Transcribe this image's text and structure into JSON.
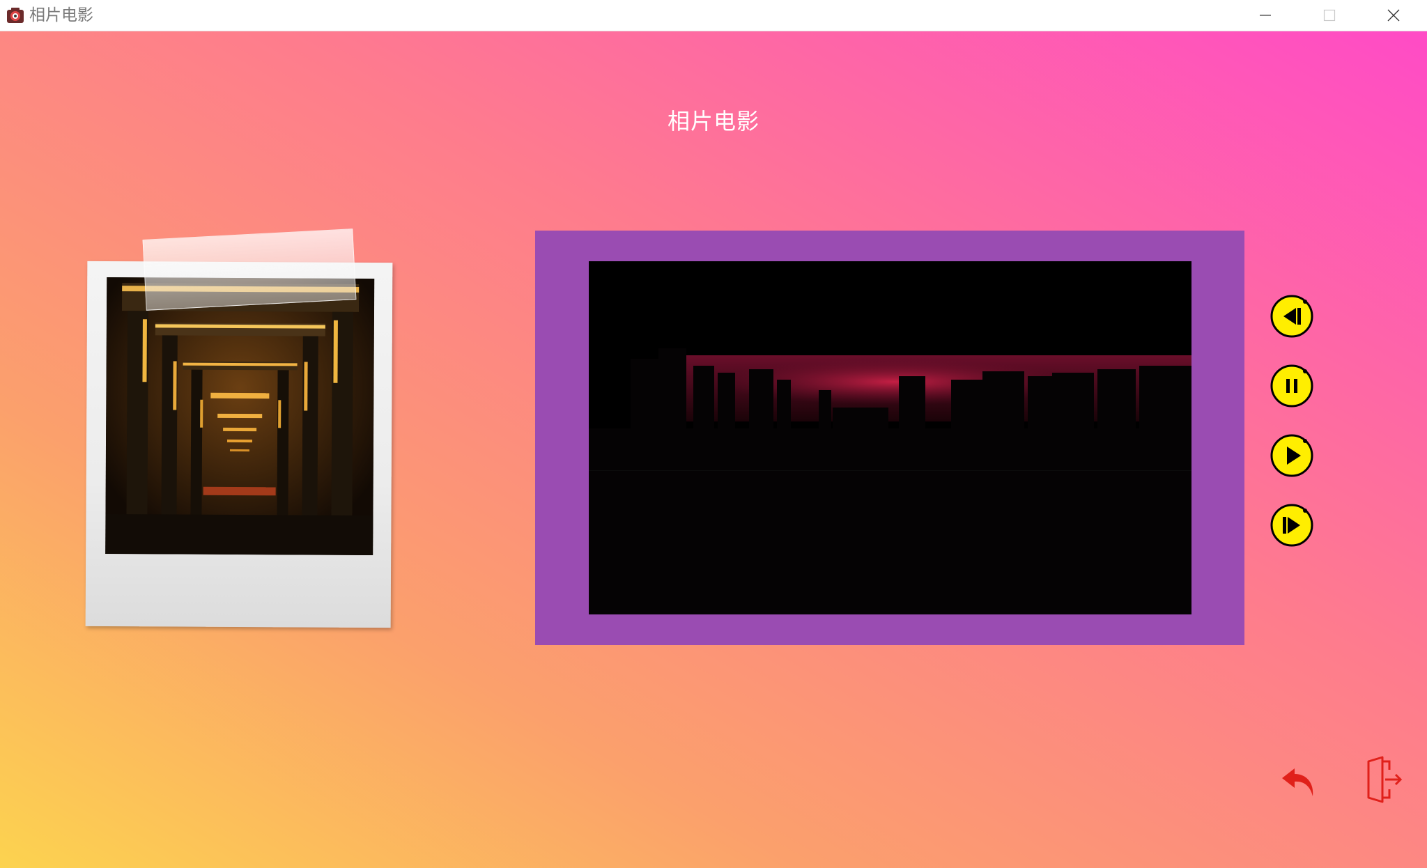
{
  "window": {
    "title": "相片电影",
    "icon": "app-camera-icon",
    "controls": [
      "minimize-icon",
      "maximize-icon",
      "close-icon"
    ]
  },
  "page": {
    "title": "相片电影"
  },
  "photo_card": {
    "image": "corridor-night-photo"
  },
  "video": {
    "image": "city-skyline-sunset-frame"
  },
  "media_controls": [
    {
      "name": "previous-icon"
    },
    {
      "name": "pause-icon"
    },
    {
      "name": "play-icon"
    },
    {
      "name": "next-icon"
    }
  ],
  "footer_actions": [
    {
      "name": "back-arrow-icon"
    },
    {
      "name": "exit-door-icon"
    }
  ],
  "colors": {
    "control_fill": "#ffee00",
    "action_red": "#e0201a",
    "frame_purple": "#9a4cb2"
  }
}
